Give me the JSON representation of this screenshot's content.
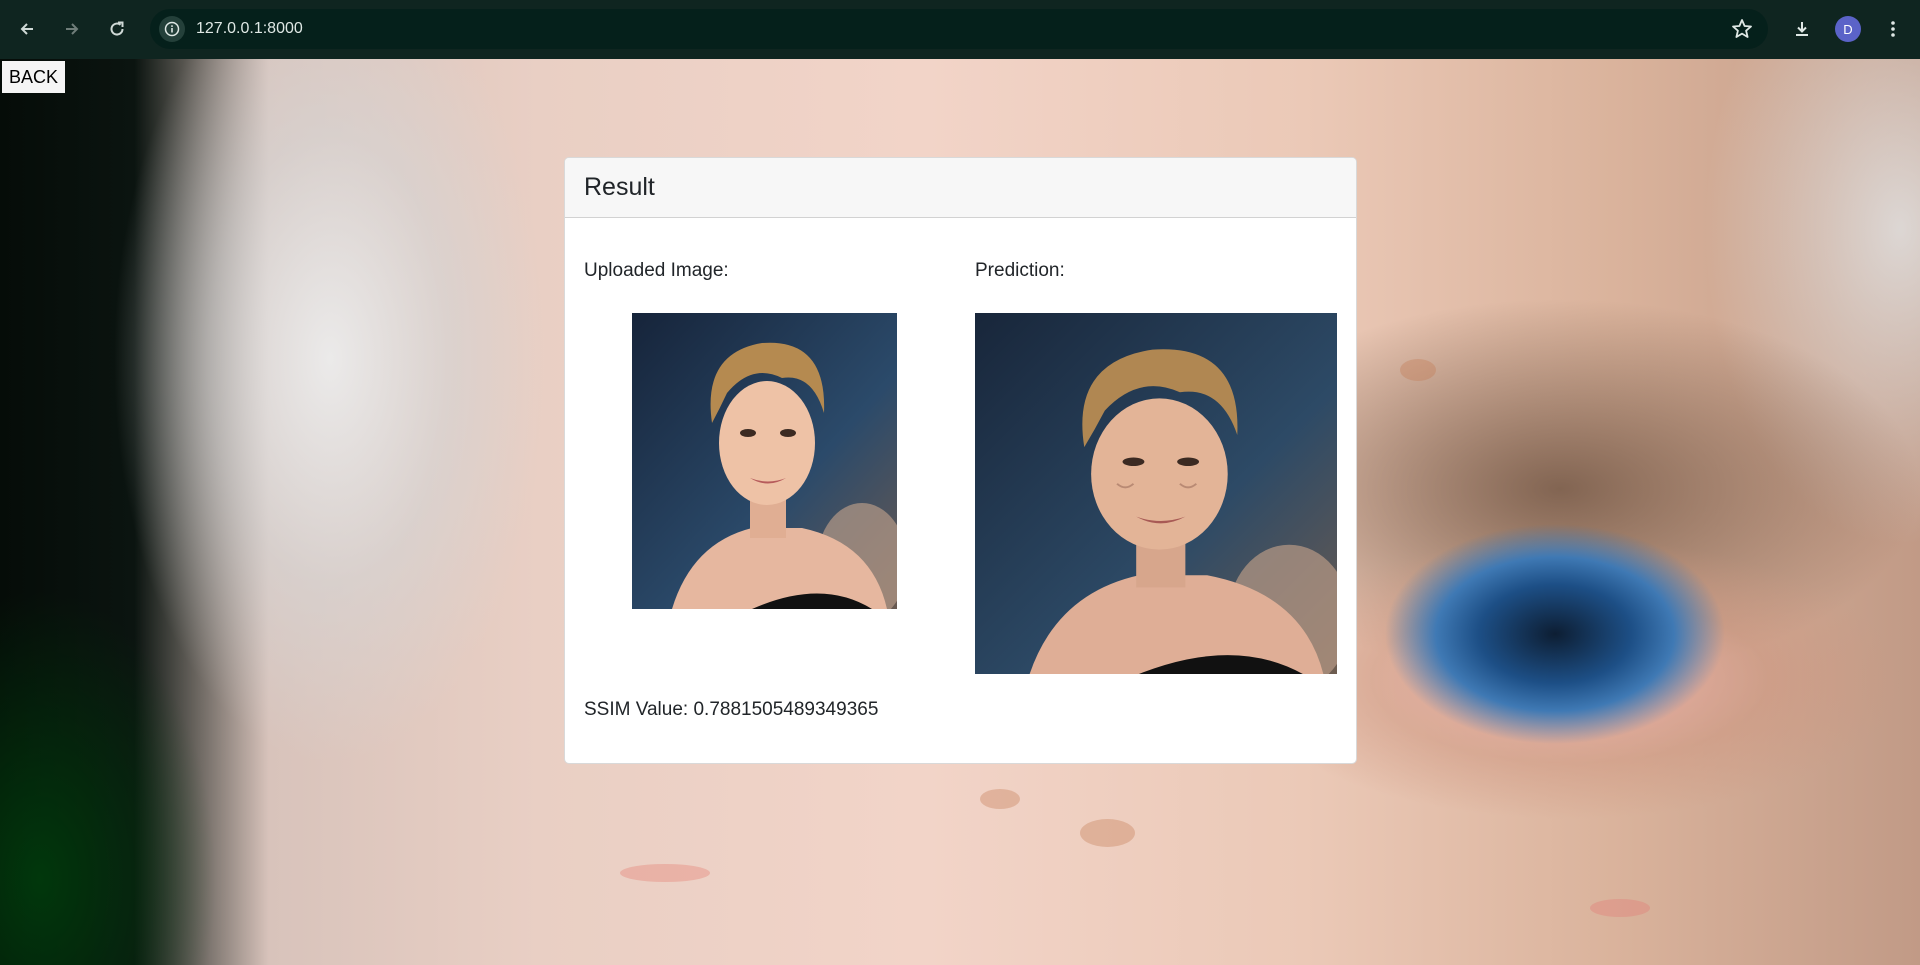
{
  "browser": {
    "url": "127.0.0.1:8000",
    "avatar_initial": "D"
  },
  "page": {
    "back_label": "BACK"
  },
  "result_card": {
    "title": "Result",
    "uploaded_label": "Uploaded Image:",
    "prediction_label": "Prediction:",
    "ssim_label": "SSIM Value:",
    "ssim_value": "0.7881505489349365",
    "ssim_text": "SSIM Value: 0.7881505489349365"
  }
}
